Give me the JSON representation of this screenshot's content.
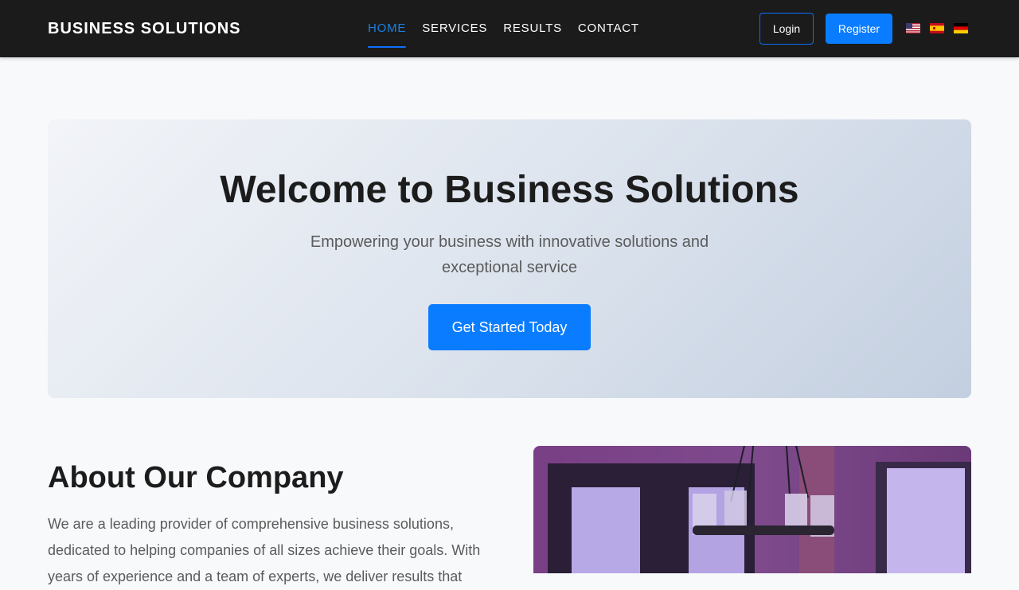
{
  "navbar": {
    "brand": "BUSINESS SOLUTIONS",
    "links": [
      {
        "label": "HOME",
        "active": true
      },
      {
        "label": "SERVICES",
        "active": false
      },
      {
        "label": "RESULTS",
        "active": false
      },
      {
        "label": "CONTACT",
        "active": false
      }
    ],
    "login_label": "Login",
    "register_label": "Register",
    "languages": [
      {
        "code": "en",
        "icon": "us-flag-icon"
      },
      {
        "code": "es",
        "icon": "spain-flag-icon"
      },
      {
        "code": "de",
        "icon": "germany-flag-icon"
      }
    ]
  },
  "hero": {
    "title": "Welcome to Business Solutions",
    "subtitle": "Empowering your business with innovative solutions and exceptional service",
    "cta_label": "Get Started Today"
  },
  "about": {
    "title": "About Our Company",
    "text": "We are a leading provider of comprehensive business solutions, dedicated to helping companies of all sizes achieve their goals. With years of experience and a team of experts, we deliver results that",
    "image": "office-chandelier-photo"
  },
  "colors": {
    "navbar_bg": "#1b1b1b",
    "accent": "#0a7cff",
    "active_link": "#1b7fe0",
    "page_bg": "#f7f9fb"
  }
}
